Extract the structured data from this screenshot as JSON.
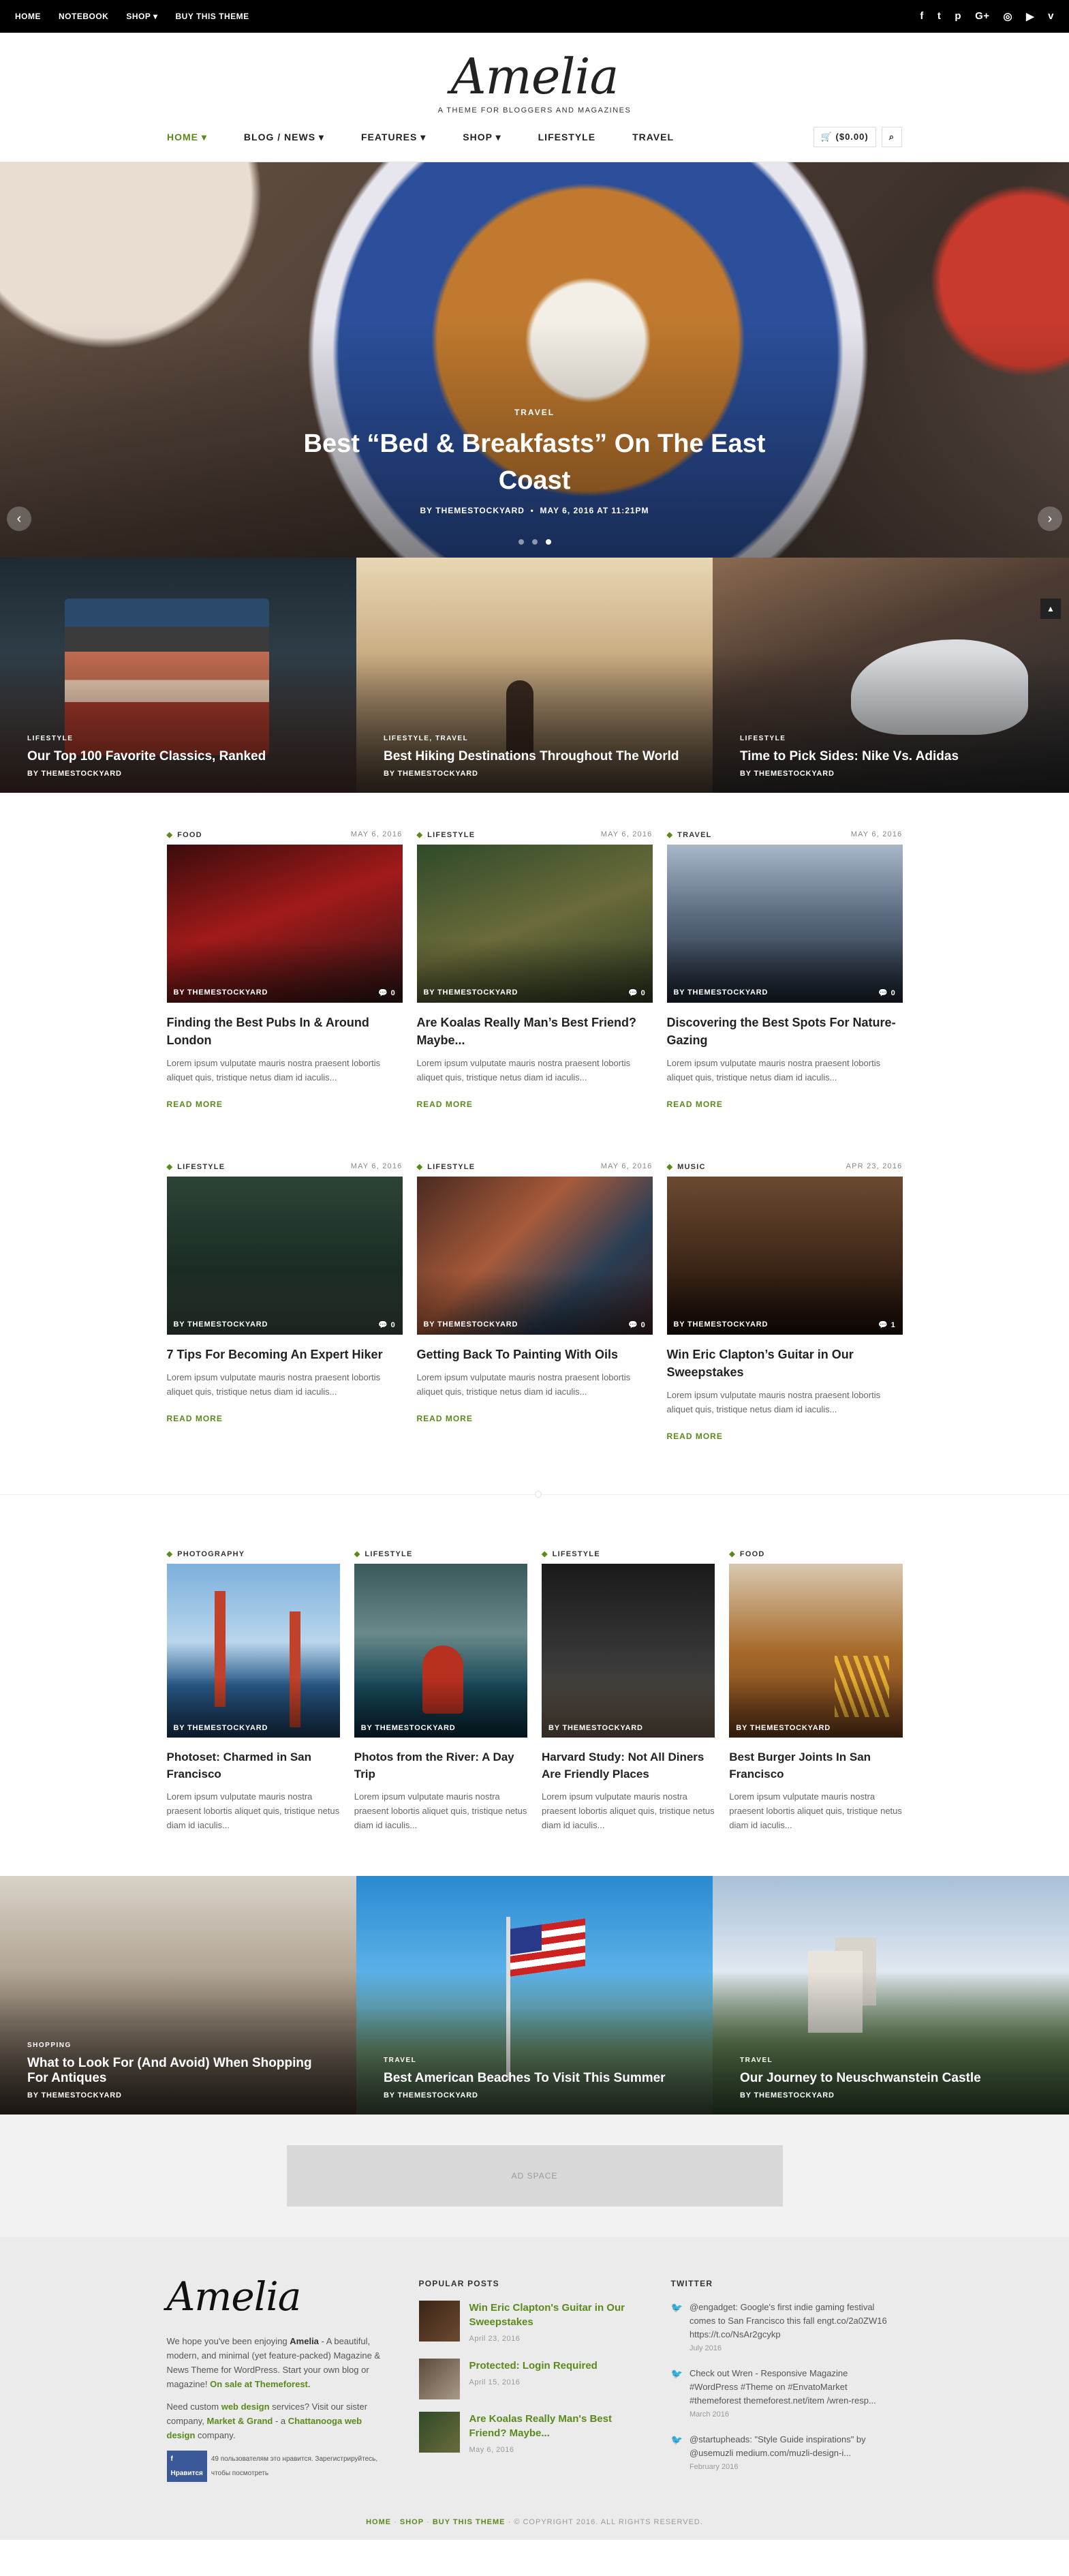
{
  "topbar": {
    "links": [
      "HOME",
      "NOTEBOOK",
      "SHOP ▾",
      "BUY THIS THEME"
    ],
    "social_icons": [
      "facebook-icon",
      "twitter-icon",
      "pinterest-icon",
      "google-plus-icon",
      "instagram-icon",
      "youtube-icon",
      "vimeo-icon"
    ]
  },
  "header": {
    "logo": "Amelia",
    "tagline": "A THEME FOR BLOGGERS AND MAGAZINES",
    "nav": [
      "HOME ▾",
      "BLOG / NEWS ▾",
      "FEATURES ▾",
      "SHOP ▾",
      "LIFESTYLE",
      "TRAVEL"
    ],
    "cart": "($0.00)"
  },
  "hero": {
    "category": "TRAVEL",
    "title": "Best “Bed & Breakfasts” On The East Coast",
    "meta_by": "BY",
    "meta_author": "THEMESTOCKYARD",
    "meta_date": "MAY 6, 2016 AT 11:21PM"
  },
  "featured": [
    {
      "category": "LIFESTYLE",
      "title": "Our Top 100 Favorite Classics, Ranked",
      "by": "BY THEMESTOCKYARD"
    },
    {
      "category": "LIFESTYLE, TRAVEL",
      "title": "Best Hiking Destinations Throughout The World",
      "by": "BY THEMESTOCKYARD"
    },
    {
      "category": "LIFESTYLE",
      "title": "Time to Pick Sides: Nike Vs. Adidas",
      "by": "BY THEMESTOCKYARD"
    }
  ],
  "posts": [
    {
      "category": "FOOD",
      "date": "MAY 6, 2016",
      "by": "BY THEMESTOCKYARD",
      "comments": "0",
      "title": "Finding the Best Pubs In & Around London",
      "excerpt": "Lorem ipsum vulputate mauris nostra praesent lobortis aliquet quis, tristique netus diam id iaculis...",
      "more": "READ MORE"
    },
    {
      "category": "LIFESTYLE",
      "date": "MAY 6, 2016",
      "by": "BY THEMESTOCKYARD",
      "comments": "0",
      "title": "Are Koalas Really Man’s Best Friend? Maybe...",
      "excerpt": "Lorem ipsum vulputate mauris nostra praesent lobortis aliquet quis, tristique netus diam id iaculis...",
      "more": "READ MORE"
    },
    {
      "category": "TRAVEL",
      "date": "MAY 6, 2016",
      "by": "BY THEMESTOCKYARD",
      "comments": "0",
      "title": "Discovering the Best Spots For Nature-Gazing",
      "excerpt": "Lorem ipsum vulputate mauris nostra praesent lobortis aliquet quis, tristique netus diam id iaculis...",
      "more": "READ MORE"
    },
    {
      "category": "LIFESTYLE",
      "date": "MAY 6, 2016",
      "by": "BY THEMESTOCKYARD",
      "comments": "0",
      "title": "7 Tips For Becoming An Expert Hiker",
      "excerpt": "Lorem ipsum vulputate mauris nostra praesent lobortis aliquet quis, tristique netus diam id iaculis...",
      "more": "READ MORE"
    },
    {
      "category": "LIFESTYLE",
      "date": "MAY 6, 2016",
      "by": "BY THEMESTOCKYARD",
      "comments": "0",
      "title": "Getting Back To Painting With Oils",
      "excerpt": "Lorem ipsum vulputate mauris nostra praesent lobortis aliquet quis, tristique netus diam id iaculis...",
      "more": "READ MORE"
    },
    {
      "category": "MUSIC",
      "date": "APR 23, 2016",
      "by": "BY THEMESTOCKYARD",
      "comments": "1",
      "title": "Win Eric Clapton’s Guitar in Our Sweepstakes",
      "excerpt": "Lorem ipsum vulputate mauris nostra praesent lobortis aliquet quis, tristique netus diam id iaculis...",
      "more": "READ MORE"
    }
  ],
  "posts4": [
    {
      "category": "PHOTOGRAPHY",
      "by": "BY THEMESTOCKYARD",
      "title": "Photoset: Charmed in San Francisco",
      "excerpt": "Lorem ipsum vulputate mauris nostra praesent lobortis aliquet quis, tristique netus diam id iaculis..."
    },
    {
      "category": "LIFESTYLE",
      "by": "BY THEMESTOCKYARD",
      "title": "Photos from the River: A Day Trip",
      "excerpt": "Lorem ipsum vulputate mauris nostra praesent lobortis aliquet quis, tristique netus diam id iaculis..."
    },
    {
      "category": "LIFESTYLE",
      "by": "BY THEMESTOCKYARD",
      "title": "Harvard Study: Not All Diners Are Friendly Places",
      "excerpt": "Lorem ipsum vulputate mauris nostra praesent lobortis aliquet quis, tristique netus diam id iaculis..."
    },
    {
      "category": "FOOD",
      "by": "BY THEMESTOCKYARD",
      "title": "Best Burger Joints In San Francisco",
      "excerpt": "Lorem ipsum vulputate mauris nostra praesent lobortis aliquet quis, tristique netus diam id iaculis..."
    }
  ],
  "bottom_tiles": [
    {
      "category": "SHOPPING",
      "title": "What to Look For (And Avoid) When Shopping For Antiques",
      "by": "BY THEMESTOCKYARD"
    },
    {
      "category": "TRAVEL",
      "title": "Best American Beaches To Visit This Summer",
      "by": "BY THEMESTOCKYARD"
    },
    {
      "category": "TRAVEL",
      "title": "Our Journey to Neuschwanstein Castle",
      "by": "BY THEMESTOCKYARD"
    }
  ],
  "ad": {
    "label": "AD SPACE"
  },
  "footer": {
    "logo": "Amelia",
    "about_1": "We hope you've been enjoying",
    "about_brand": "Amelia",
    "about_2": "- A beautiful, modern, and minimal (yet feature-packed) Magazine & News Theme for WordPress. Start your own blog or magazine!",
    "about_sale": "On sale at Themeforest.",
    "services_1": "Need custom",
    "services_link": "web design",
    "services_2": "services? Visit our sister company,",
    "services_company": "Market & Grand",
    "services_3": "- a",
    "services_city": "Chattanooga web design",
    "services_4": "company.",
    "fb_button": "Нравится",
    "fb_text": "49 пользователям это нравится. Зарегистрируйтесь, чтобы посмотреть",
    "popular_heading": "POPULAR POSTS",
    "popular": [
      {
        "title": "Win Eric Clapton's Guitar in Our Sweepstakes",
        "date": "April 23, 2016"
      },
      {
        "title": "Protected: Login Required",
        "date": "April 15, 2016"
      },
      {
        "title": "Are Koalas Really Man's Best Friend? Maybe...",
        "date": "May 6, 2016"
      }
    ],
    "twitter_heading": "TWITTER",
    "tweets": [
      {
        "text": "@engadget: Google's first indie gaming festival comes to San Francisco this fall engt.co/2a0ZW16 https://t.co/NsAr2gcykp",
        "date": "July 2016"
      },
      {
        "text": "Check out Wren - Responsive Magazine #WordPress #Theme on #EnvatoMarket #themeforest themeforest.net/item /wren-resp...",
        "date": "March 2016"
      },
      {
        "text": "@startupheads: \"Style Guide inspirations\" by @usemuzli medium.com/muzli-design-i...",
        "date": "February 2016"
      }
    ],
    "copy_links": [
      "HOME",
      "SHOP",
      "BUY THIS THEME"
    ],
    "copy_text": "© COPYRIGHT 2016. ALL RIGHTS RESERVED."
  },
  "colors": {
    "accent": "#5a8a1c",
    "topbar": "#000000",
    "footer_bg": "#ebebeb"
  }
}
